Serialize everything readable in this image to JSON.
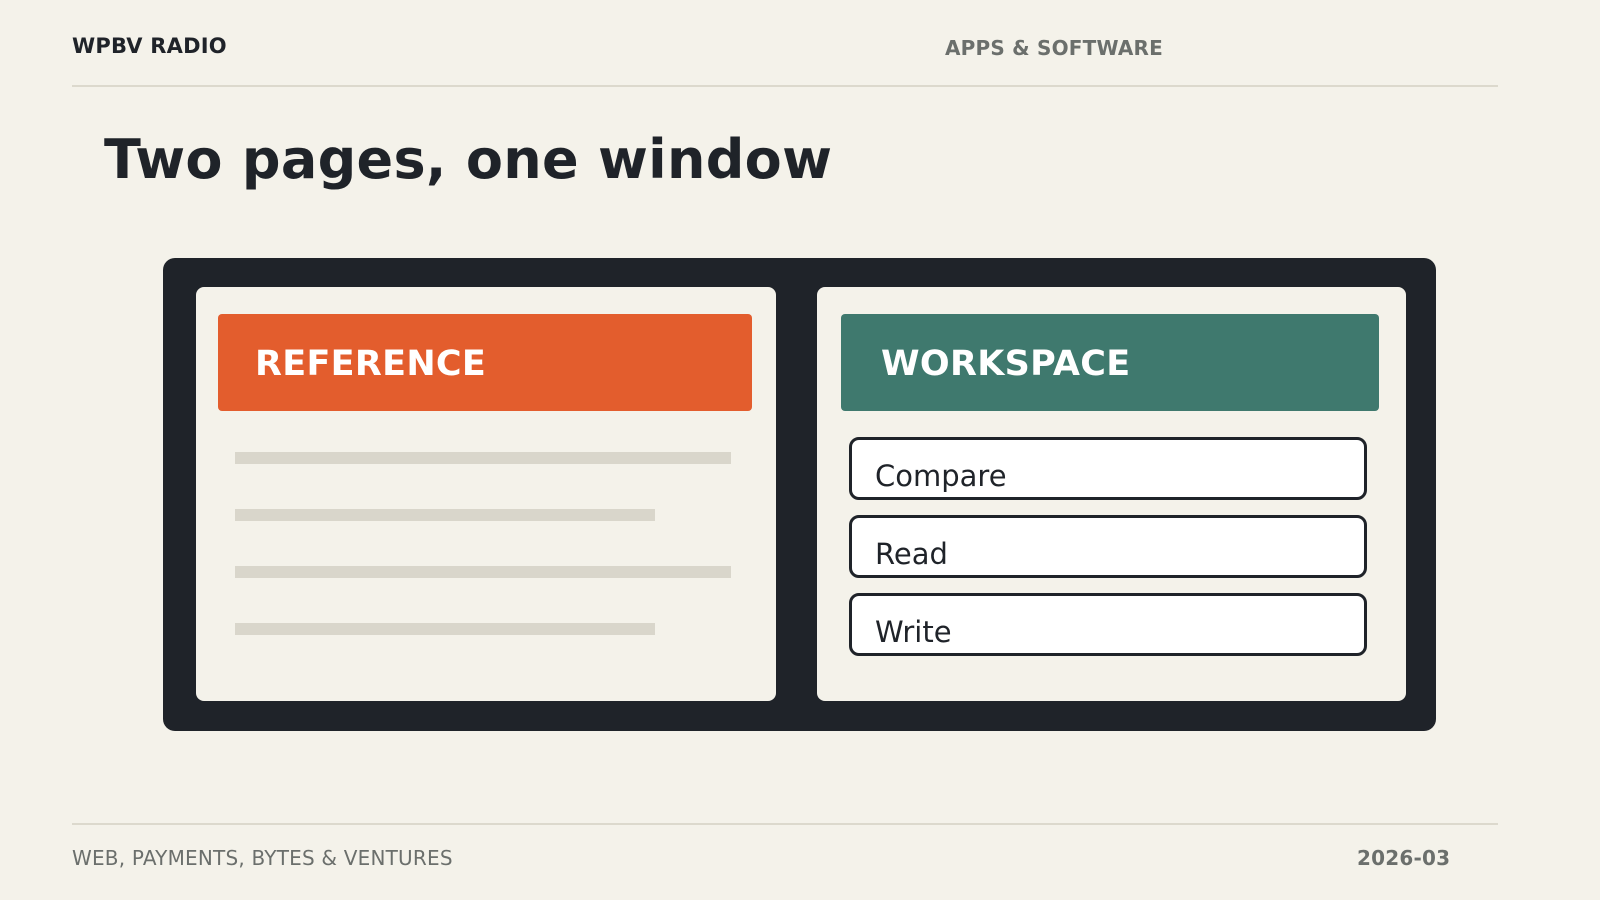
{
  "header": {
    "brand": "WPBV RADIO",
    "section": "APPS & SOFTWARE"
  },
  "slide": {
    "title": "Two pages, one window"
  },
  "window": {
    "reference_pane": {
      "label": "REFERENCE",
      "accent_color": "#e35d2d"
    },
    "workspace_pane": {
      "label": "WORKSPACE",
      "accent_color": "#3f796e",
      "actions": [
        "Compare",
        "Read",
        "Write"
      ]
    }
  },
  "footer": {
    "tagline": "WEB, PAYMENTS, BYTES & VENTURES",
    "date": "2026-03"
  }
}
